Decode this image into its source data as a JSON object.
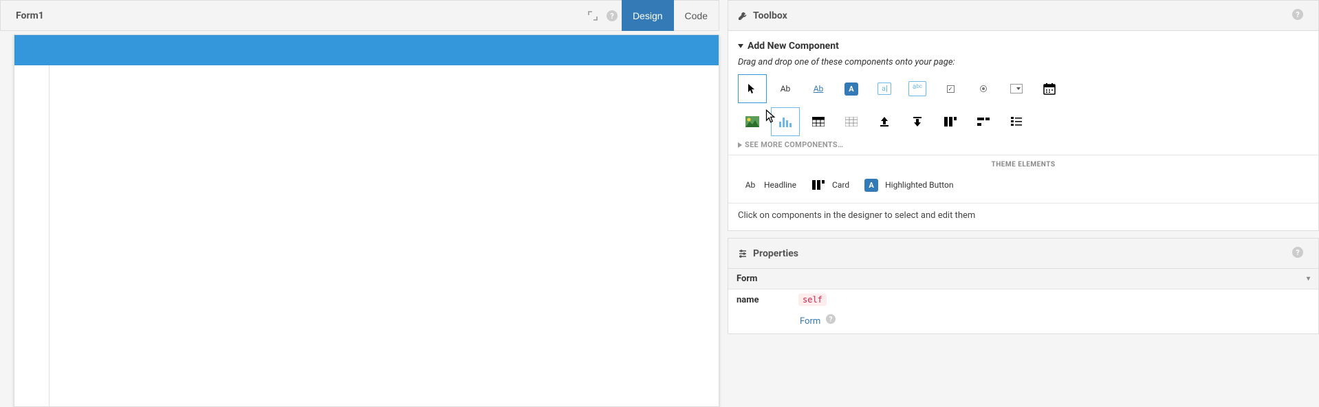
{
  "left": {
    "title": "Form1",
    "tabs": {
      "design": "Design",
      "code": "Code"
    }
  },
  "toolbox": {
    "title": "Toolbox",
    "section_title": "Add New Component",
    "description": "Drag and drop one of these components onto your page:",
    "see_more": "SEE MORE COMPONENTS…",
    "theme_heading": "THEME ELEMENTS",
    "theme": {
      "headline": "Headline",
      "card": "Card",
      "highlighted_button": "Highlighted Button"
    },
    "hint": "Click on components in the designer to select and edit them"
  },
  "properties": {
    "title": "Properties",
    "type": "Form",
    "name_label": "name",
    "name_value": "self",
    "form_link": "Form"
  }
}
